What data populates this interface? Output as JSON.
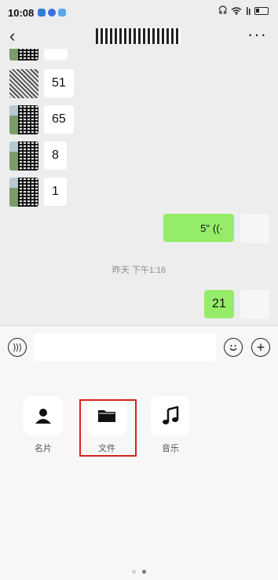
{
  "status_bar": {
    "time": "10:08"
  },
  "nav": {
    "back_icon": "‹",
    "more_icon": "···"
  },
  "messages": [
    {
      "from": "other",
      "text": "51"
    },
    {
      "from": "other",
      "text": "65"
    },
    {
      "from": "other",
      "text": "8"
    },
    {
      "from": "other",
      "text": "1"
    },
    {
      "from": "self",
      "type": "voice",
      "text": "5\""
    },
    {
      "type": "timestamp",
      "text": "昨天 下午1:16"
    },
    {
      "from": "self",
      "text": "21"
    }
  ],
  "tools": [
    {
      "label": "名片",
      "icon": "person-icon"
    },
    {
      "label": "文件",
      "icon": "folder-icon"
    },
    {
      "label": "音乐",
      "icon": "music-note-icon"
    }
  ],
  "colors": {
    "self_bubble": "#95ec69",
    "highlight": "#d9231f"
  }
}
